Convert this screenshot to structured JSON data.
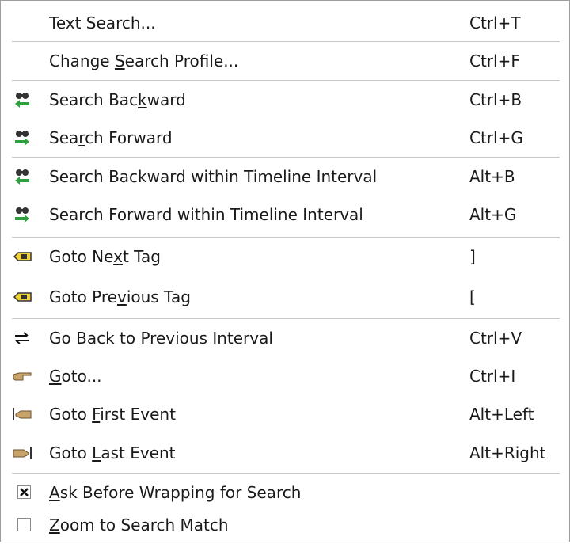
{
  "menu": {
    "items": [
      {
        "pre": "Text Search...",
        "u": "",
        "post": "",
        "shortcut": "Ctrl+T"
      },
      {
        "pre": "Change ",
        "u": "S",
        "post": "earch Profile...",
        "shortcut": "Ctrl+F"
      },
      {
        "pre": "Search Bac",
        "u": "k",
        "post": "ward",
        "shortcut": "Ctrl+B",
        "icon": "search-backward-icon"
      },
      {
        "pre": "Sea",
        "u": "r",
        "post": "ch Forward",
        "shortcut": "Ctrl+G",
        "icon": "search-forward-icon"
      },
      {
        "pre": "Search Backward within Timeline Interval",
        "u": "",
        "post": "",
        "shortcut": "Alt+B",
        "icon": "search-backward-icon"
      },
      {
        "pre": "Search Forward within Timeline Interval",
        "u": "",
        "post": "",
        "shortcut": "Alt+G",
        "icon": "search-forward-icon"
      },
      {
        "pre": "Goto Ne",
        "u": "x",
        "post": "t Tag",
        "shortcut": "]",
        "icon": "tag-icon"
      },
      {
        "pre": "Goto Pre",
        "u": "v",
        "post": "ious Tag",
        "shortcut": "[",
        "icon": "tag-icon"
      },
      {
        "pre": "Go Back to Previous Interval",
        "u": "",
        "post": "",
        "shortcut": "Ctrl+V",
        "icon": "swap-arrows-icon"
      },
      {
        "pre": "",
        "u": "G",
        "post": "oto...",
        "shortcut": "Ctrl+I",
        "icon": "pointing-hand-icon"
      },
      {
        "pre": "Goto ",
        "u": "F",
        "post": "irst Event",
        "shortcut": "Alt+Left",
        "icon": "hand-first-icon"
      },
      {
        "pre": "Goto ",
        "u": "L",
        "post": "ast Event",
        "shortcut": "Alt+Right",
        "icon": "hand-last-icon"
      },
      {
        "pre": "",
        "u": "A",
        "post": "sk Before Wrapping for Search",
        "shortcut": "",
        "checked": true
      },
      {
        "pre": "",
        "u": "Z",
        "post": "oom to Search Match",
        "shortcut": "",
        "checked": false
      }
    ]
  },
  "colors": {
    "text": "#1a1a1a",
    "separator": "#c8c8c8",
    "border": "#9c9c9c",
    "arrow_green": "#2e9e3e",
    "tag_yellow": "#f2d23a",
    "hand_tan": "#c9a46a"
  }
}
